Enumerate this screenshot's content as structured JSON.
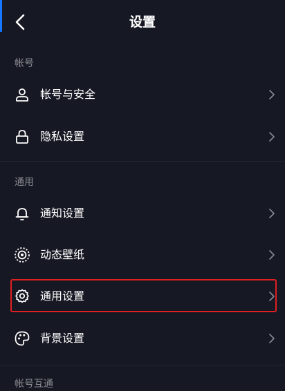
{
  "header": {
    "title": "设置"
  },
  "sections": [
    {
      "title": "帐号",
      "items": [
        {
          "label": "帐号与安全",
          "icon": "user-icon"
        },
        {
          "label": "隐私设置",
          "icon": "lock-icon"
        }
      ]
    },
    {
      "title": "通用",
      "items": [
        {
          "label": "通知设置",
          "icon": "bell-icon"
        },
        {
          "label": "动态壁纸",
          "icon": "dynamic-wallpaper-icon"
        },
        {
          "label": "通用设置",
          "icon": "gear-icon"
        },
        {
          "label": "背景设置",
          "icon": "palette-icon"
        }
      ]
    },
    {
      "title": "帐号互通",
      "items": []
    }
  ],
  "colors": {
    "background": "#161823",
    "section_title": "#8a8b91",
    "highlight_border": "#e02020",
    "accent_blue": "#1677ff"
  }
}
